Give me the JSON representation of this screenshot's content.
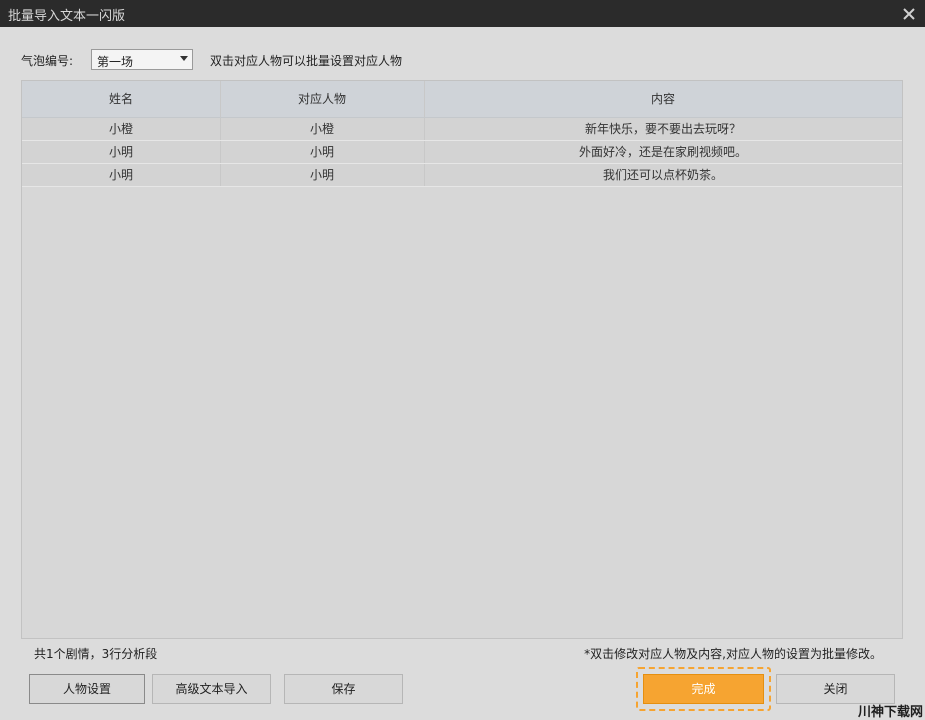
{
  "window": {
    "title": "批量导入文本一闪版"
  },
  "toolbar": {
    "bubble_label": "气泡编号:",
    "bubble_value": "第一场",
    "hint": "双击对应人物可以批量设置对应人物"
  },
  "table": {
    "headers": [
      "姓名",
      "对应人物",
      "内容"
    ],
    "rows": [
      [
        "小橙",
        "小橙",
        "新年快乐，要不要出去玩呀？"
      ],
      [
        "小明",
        "小明",
        "外面好冷，还是在家刷视频吧。"
      ],
      [
        "小明",
        "小明",
        "我们还可以点杯奶茶。"
      ]
    ]
  },
  "status": {
    "summary": "共1个剧情，3行分析段",
    "note": "*双击修改对应人物及内容,对应人物的设置为批量修改。"
  },
  "buttons": {
    "people": "人物设置",
    "advanced": "高级文本导入",
    "save": "保存",
    "done": "完成",
    "close": "关闭"
  },
  "watermark": "川神下载网",
  "colors": {
    "accent": "#f6a431",
    "titlebar": "#2b2b2b"
  }
}
